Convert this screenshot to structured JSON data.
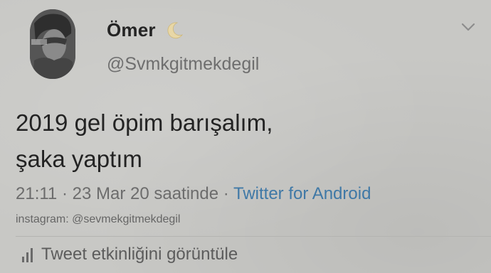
{
  "tweet": {
    "display_name": "Ömer",
    "name_emoji_icon": "crescent-moon-icon",
    "handle": "@Svmkgitmekdegil",
    "text_line1": "2019 gel öpim barışalım,",
    "text_line2": "şaka yaptım",
    "time": "21:11",
    "separator1": "·",
    "date": "23 Mar 20 saatinde",
    "separator2": "·",
    "source_app": "Twitter for Android",
    "watermark": "instagram: @sevmekgitmekdegil",
    "activity_label": "Tweet etkinliğini görüntüle",
    "activity_icon": "bar-chart-icon",
    "menu_icon": "chevron-down-icon"
  },
  "colors": {
    "background": "#c8c8c5",
    "text": "#232323",
    "muted": "#6c6c6c",
    "link": "#3f78a6"
  }
}
